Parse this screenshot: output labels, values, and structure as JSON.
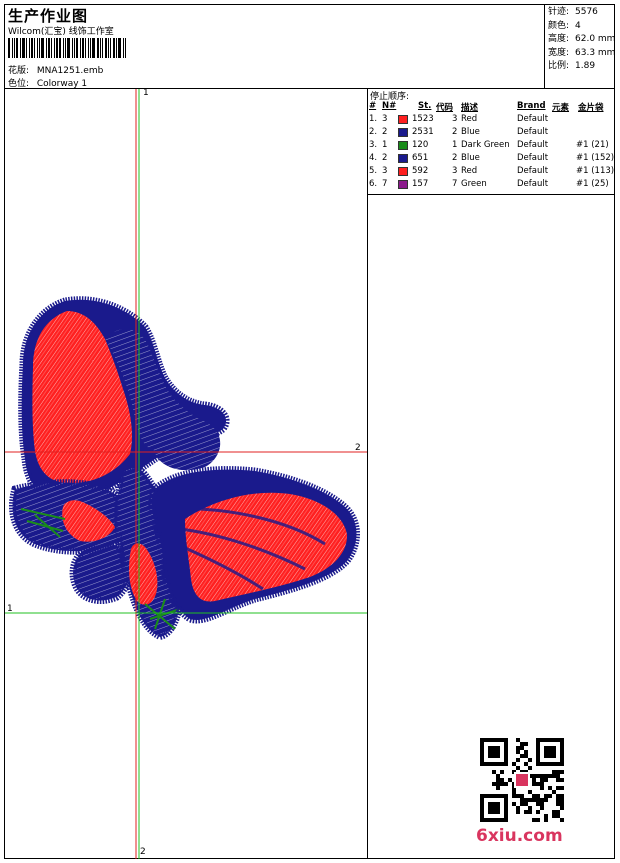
{
  "header": {
    "title": "生产作业图",
    "studio": "Wilcom(汇宝) 线饰工作室",
    "design_label": "花版:",
    "design_value": "MNA1251.emb",
    "colorway_label": "色位:",
    "colorway_value": "Colorway 1"
  },
  "stats": [
    {
      "label": "针迹:",
      "value": "5576"
    },
    {
      "label": "颜色:",
      "value": "4"
    },
    {
      "label": "高度:",
      "value": "62.0 mm"
    },
    {
      "label": "宽度:",
      "value": "63.3 mm"
    },
    {
      "label": "比例:",
      "value": "1.89"
    }
  ],
  "stop_sequence": {
    "title": "停止顺序:",
    "headers": {
      "num": "#",
      "needle": "N#",
      "stitches": "St.",
      "code": "代码",
      "desc": "描述",
      "brand": "Brand",
      "element": "元素",
      "sequin": "金片袋"
    },
    "rows": [
      {
        "num": "1.",
        "needle": "3",
        "color": "#ff2020",
        "stitches": "1523",
        "code": "3",
        "desc": "Red",
        "brand": "Default",
        "sequin": ""
      },
      {
        "num": "2.",
        "needle": "2",
        "color": "#1a1a8c",
        "stitches": "2531",
        "code": "2",
        "desc": "Blue",
        "brand": "Default",
        "sequin": ""
      },
      {
        "num": "3.",
        "needle": "1",
        "color": "#1a8c1a",
        "stitches": "120",
        "code": "1",
        "desc": "Dark Green",
        "brand": "Default",
        "sequin": "#1 (21)"
      },
      {
        "num": "4.",
        "needle": "2",
        "color": "#1a1a8c",
        "stitches": "651",
        "code": "2",
        "desc": "Blue",
        "brand": "Default",
        "sequin": "#1 (152)"
      },
      {
        "num": "5.",
        "needle": "3",
        "color": "#ff2020",
        "stitches": "592",
        "code": "3",
        "desc": "Red",
        "brand": "Default",
        "sequin": "#1 (113)"
      },
      {
        "num": "6.",
        "needle": "7",
        "color": "#8c1a8c",
        "stitches": "157",
        "code": "7",
        "desc": "Green",
        "brand": "Default",
        "sequin": "#1 (25)"
      }
    ]
  },
  "guides": {
    "top": "1",
    "right": "2",
    "left": "1",
    "bottom": "2"
  },
  "colors": {
    "red": "#ff2020",
    "blue": "#1a1a8c",
    "green": "#1a8c1a",
    "purple": "#8c1a8c",
    "guide_red": "#e02020",
    "guide_green": "#20c020",
    "brand_pink": "#d9355f"
  },
  "watermark": {
    "site": "6xiu.com",
    "qr_icon": "qr-code-icon"
  }
}
